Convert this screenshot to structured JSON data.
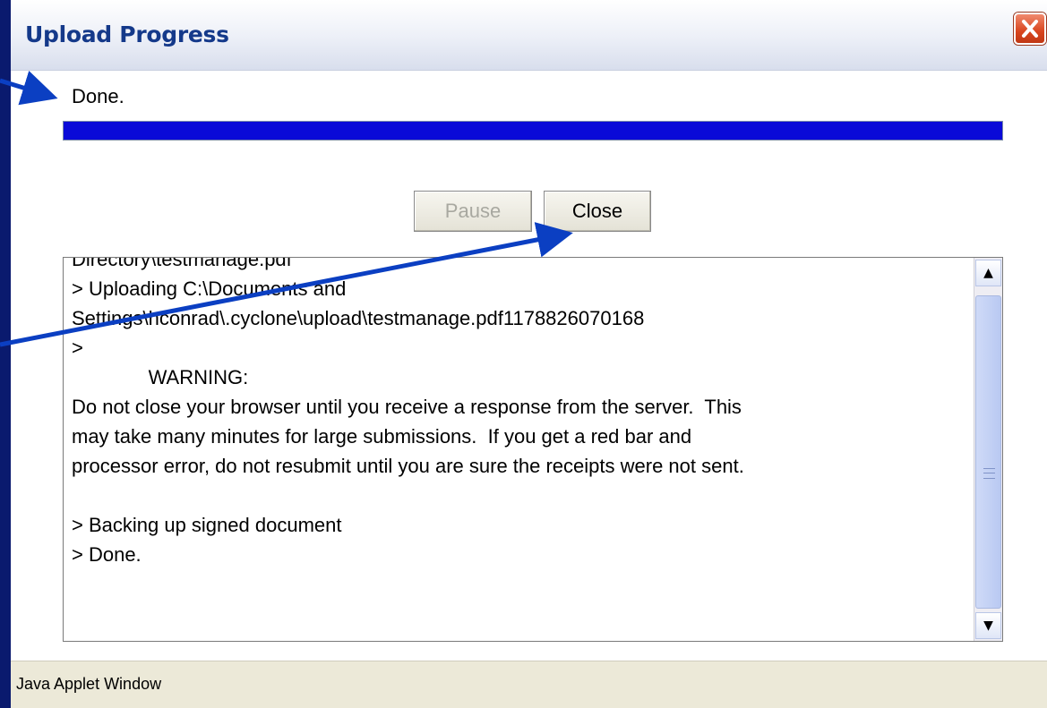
{
  "window": {
    "title": "Upload Progress",
    "close_icon": "close-x-icon"
  },
  "status_text": "Done.",
  "progress": {
    "percent": 100,
    "fill_color": "#0a0ad8"
  },
  "buttons": {
    "pause_label": "Pause",
    "close_label": "Close"
  },
  "log": {
    "lines": [
      "Directory\\testmanage.pdf",
      "> Uploading C:\\Documents and",
      "Settings\\hconrad\\.cyclone\\upload\\testmanage.pdf1178826070168",
      ">",
      "              WARNING:",
      "Do not close your browser until you receive a response from the server.  This",
      "may take many minutes for large submissions.  If you get a red bar and",
      "processor error, do not resubmit until you are sure the receipts were not sent.",
      "",
      "> Backing up signed document",
      "> Done."
    ]
  },
  "statusbar": {
    "text": "Java Applet Window"
  },
  "colors": {
    "background": "#0a1a6e",
    "title": "#14398a",
    "arrow": "#0b3fc2"
  }
}
